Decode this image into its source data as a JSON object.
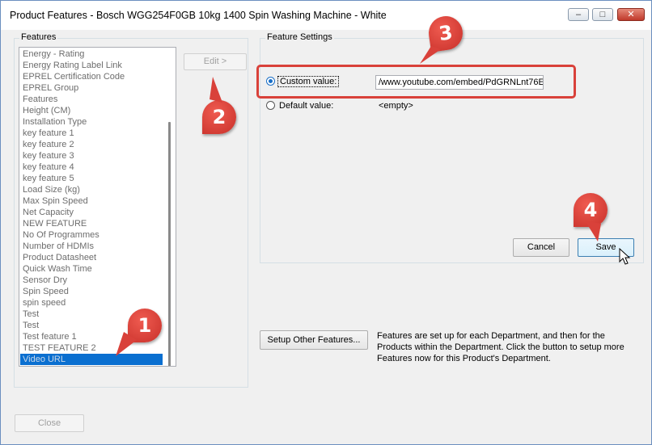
{
  "window": {
    "title": "Product Features - Bosch WGG254F0GB 10kg 1400 Spin Washing Machine - White",
    "minimize": "–",
    "maximize": "□",
    "close": "✕"
  },
  "features_group": {
    "label": "Features",
    "items": [
      "Energy - Rating",
      "Energy Rating Label Link",
      "EPREL Certification Code",
      "EPREL Group",
      "Features",
      "Height (CM)",
      "Installation Type",
      "key feature 1",
      "key feature 2",
      "key feature 3",
      "key feature 4",
      "key feature 5",
      "Load Size (kg)",
      "Max Spin Speed",
      "Net Capacity",
      "NEW FEATURE",
      "No Of Programmes",
      "Number of HDMIs",
      "Product Datasheet",
      "Quick Wash Time",
      "Sensor Dry",
      "Spin Speed",
      "spin speed",
      "Test",
      "Test",
      "Test feature 1",
      "TEST FEATURE 2",
      "Video URL"
    ],
    "selected_index": 27
  },
  "edit_button": "Edit >",
  "settings_group": {
    "label": "Feature Settings",
    "custom_label": "Custom value:",
    "custom_value": "/www.youtube.com/embed/PdGRNLnt76E",
    "default_label": "Default value:",
    "default_value": "<empty>",
    "cancel": "Cancel",
    "save": "Save"
  },
  "setup_button": "Setup Other Features...",
  "info_text": "Features are set up for each Department, and then for the Products within the Department. Click the button to setup more Features now for this Product's Department.",
  "close_button": "Close",
  "annotations": {
    "marker1": "1",
    "marker2": "2",
    "marker3": "3",
    "marker4": "4",
    "marker_color": "#d9413a"
  }
}
